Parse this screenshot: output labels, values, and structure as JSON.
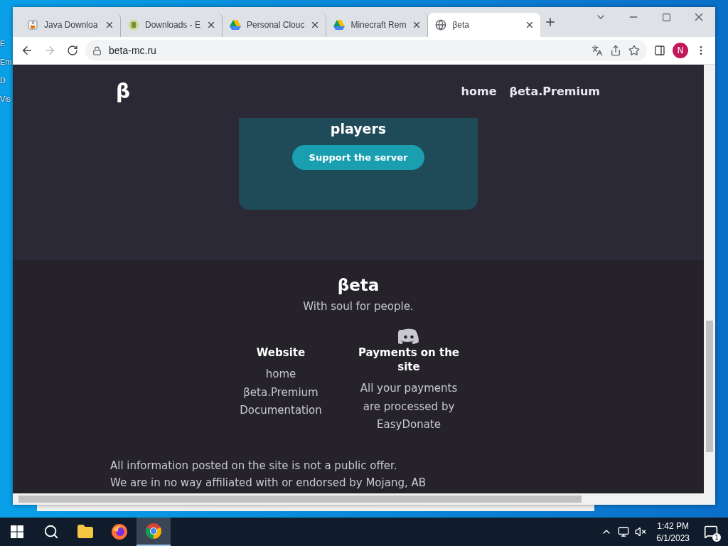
{
  "desktop_labels": [
    "E",
    "Em",
    "D",
    "Vis"
  ],
  "tabs": [
    {
      "title": "Java Downloa",
      "selected": false
    },
    {
      "title": "Downloads - E",
      "selected": false
    },
    {
      "title": "Personal Clouc",
      "selected": false
    },
    {
      "title": "Minecraft Rem",
      "selected": false
    },
    {
      "title": "βeta",
      "selected": true
    }
  ],
  "address": "beta-mc.ru",
  "profile": "N",
  "site": {
    "logo": "β",
    "nav": [
      "home",
      "βeta.Premium"
    ],
    "card": {
      "heading": "players",
      "button": "Support the server"
    },
    "footer": {
      "title": "βeta",
      "tagline": "With soul for people.",
      "columns": [
        {
          "heading": "Website",
          "links": [
            "home",
            "βeta.Premium",
            "Documentation"
          ]
        },
        {
          "heading": "Payments on the site",
          "text": "All your payments are processed by EasyDonate"
        }
      ],
      "notes": [
        "All information posted on the site is not a public offer.",
        "We are in no way affiliated with or endorsed by Mojang, AB"
      ]
    }
  },
  "taskbar": {
    "apps": [
      {
        "selected": false
      },
      {
        "selected": false
      },
      {
        "selected": true
      }
    ],
    "time": "1:42 PM",
    "date": "6/1/2023",
    "notifications": "1"
  }
}
